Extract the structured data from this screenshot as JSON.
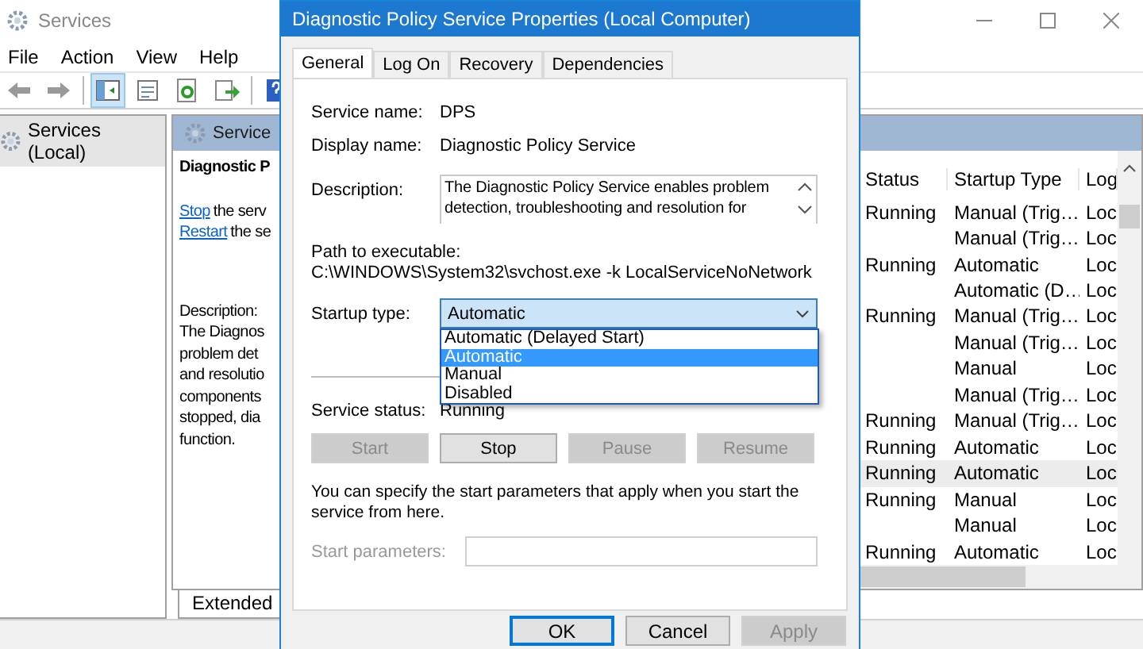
{
  "services_window": {
    "title": "Services",
    "menu": [
      "File",
      "Action",
      "View",
      "Help"
    ],
    "tree": [
      {
        "label": "Services (Local)",
        "selected": true
      }
    ],
    "detail": {
      "header": "Service",
      "name": "Diagnostic P",
      "actions": [
        {
          "link": "Stop",
          "rest": "the serv"
        },
        {
          "link": "Restart",
          "rest": "the se"
        }
      ],
      "description_label": "Description:",
      "description_lines": [
        "The Diagnos",
        "problem det",
        "and resolutio",
        "components",
        "stopped, dia",
        "function."
      ]
    },
    "list": {
      "columns": [
        "Status",
        "Startup Type",
        "Log"
      ],
      "rows": [
        {
          "status": "Running",
          "startup_type": "Manual (Trig…",
          "column_3": "Loc",
          "selected": false
        },
        {
          "startup_type": "Manual (Trig…",
          "column_3": "Loc",
          "selected": false
        },
        {
          "status": "Running",
          "startup_type": "Automatic",
          "column_3": "Loc",
          "selected": false
        },
        {
          "startup_type": "Automatic (D…",
          "column_3": "Loc",
          "selected": false
        },
        {
          "status": "Running",
          "startup_type": "Manual (Trig…",
          "column_3": "Loc",
          "selected": false
        },
        {
          "startup_type": "Manual (Trig…",
          "column_3": "Loc",
          "selected": false
        },
        {
          "startup_type": "Manual",
          "column_3": "Loc",
          "selected": false
        },
        {
          "startup_type": "Manual (Trig…",
          "column_3": "Loc",
          "selected": false
        },
        {
          "status": "Running",
          "startup_type": "Manual (Trig…",
          "column_3": "Loc",
          "selected": false
        },
        {
          "status": "Running",
          "startup_type": "Automatic",
          "column_3": "Loc",
          "selected": false
        },
        {
          "status": "Running",
          "startup_type": "Automatic",
          "column_3": "Loc",
          "selected": true
        },
        {
          "status": "Running",
          "startup_type": "Manual",
          "column_3": "Loc",
          "selected": false
        },
        {
          "startup_type": "Manual",
          "column_3": "Loc",
          "selected": false
        },
        {
          "status": "Running",
          "startup_type": "Automatic",
          "column_3": "Loc",
          "selected": false
        }
      ]
    },
    "view_tabs": [
      {
        "label": "Extended",
        "selected": true
      }
    ]
  },
  "dialog": {
    "title": "Diagnostic Policy Service Properties (Local Computer)",
    "tabs": [
      {
        "label": "General",
        "selected": true
      },
      {
        "label": "Log On",
        "selected": false
      },
      {
        "label": "Recovery",
        "selected": false
      },
      {
        "label": "Dependencies",
        "selected": false
      }
    ],
    "fields": [
      {
        "label": "Service name:",
        "value": "DPS"
      },
      {
        "label": "Display name:",
        "value": "Diagnostic Policy Service"
      }
    ],
    "description": {
      "label": "Description:",
      "value": "The Diagnostic Policy Service enables problem detection, troubleshooting and resolution for"
    },
    "path": {
      "label": "Path to executable:",
      "value": "C:\\WINDOWS\\System32\\svchost.exe -k LocalServiceNoNetwork"
    },
    "startup_type": {
      "label": "Startup type:",
      "value": "Automatic",
      "expanded": true,
      "options": [
        {
          "label": "Automatic (Delayed Start)",
          "selected": false
        },
        {
          "label": "Automatic",
          "selected": true
        },
        {
          "label": "Manual",
          "selected": false
        },
        {
          "label": "Disabled",
          "selected": false
        }
      ]
    },
    "service_status": {
      "label": "Service status:",
      "value": "Running"
    },
    "control_buttons": [
      {
        "label": "Start",
        "disabled": true
      },
      {
        "label": "Stop",
        "disabled": false
      },
      {
        "label": "Pause",
        "disabled": true
      },
      {
        "label": "Resume",
        "disabled": true
      }
    ],
    "hint": "You can specify the start parameters that apply when you start the service from here.",
    "start_parameters": {
      "label": "Start parameters:",
      "disabled": true
    },
    "buttons": [
      {
        "label": "OK",
        "default": true,
        "disabled": false
      },
      {
        "label": "Cancel",
        "default": false,
        "disabled": false
      },
      {
        "label": "Apply",
        "default": false,
        "disabled": true
      }
    ]
  }
}
